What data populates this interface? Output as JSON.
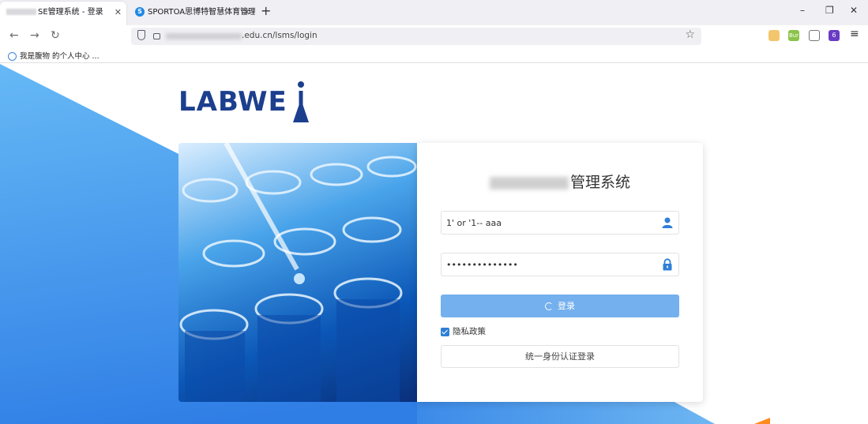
{
  "browser": {
    "tabs": [
      {
        "label": "SE管理系统 - 登录",
        "active": true
      },
      {
        "label": "SPORTOA思博特智慧体育管理",
        "active": false
      }
    ],
    "new_tab": "+",
    "window_controls": {
      "minimize": "–",
      "restore": "❐",
      "close": "✕"
    },
    "url_text": ".edu.cn/lsms/login",
    "bookmarks": [
      {
        "label": "我是腹物 的个人中心 ..."
      }
    ],
    "extension_badge": "Bur",
    "extension_badge_count": "6"
  },
  "page": {
    "logo_text": "LABWE",
    "form": {
      "title_suffix": "管理系统",
      "username_value": "1' or '1-- aaa",
      "password_value": "••••••••••••••",
      "login_label": "登录",
      "privacy_label": "隐私政策",
      "privacy_checked": true,
      "sso_label": "统一身份认证登录"
    }
  },
  "colors": {
    "accent": "#74b0ed",
    "logo": "#1c3f8e",
    "icon_blue": "#2e7fd8"
  }
}
